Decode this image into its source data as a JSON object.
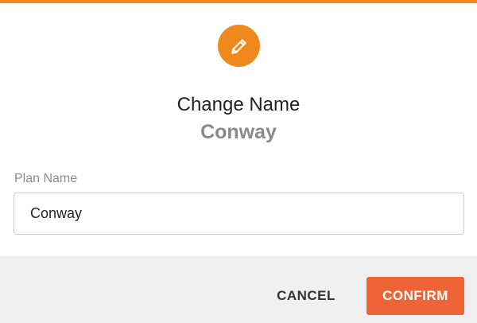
{
  "dialog": {
    "title": "Change Name",
    "subtitle": "Conway",
    "icon": "pencil-icon"
  },
  "form": {
    "plan_name_label": "Plan Name",
    "plan_name_value": "Conway"
  },
  "actions": {
    "cancel_label": "CANCEL",
    "confirm_label": "CONFIRM"
  },
  "colors": {
    "accent": "#f08a1c",
    "confirm": "#ef6436",
    "footer_bg": "#f0f0f0",
    "subtitle": "#8a8a8a"
  }
}
